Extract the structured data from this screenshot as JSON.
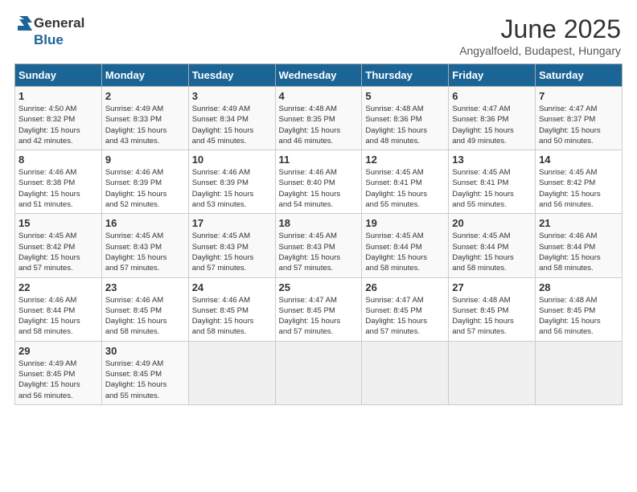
{
  "header": {
    "logo_general": "General",
    "logo_blue": "Blue",
    "main_title": "June 2025",
    "subtitle": "Angyalfoeld, Budapest, Hungary"
  },
  "calendar": {
    "days_of_week": [
      "Sunday",
      "Monday",
      "Tuesday",
      "Wednesday",
      "Thursday",
      "Friday",
      "Saturday"
    ],
    "weeks": [
      [
        {
          "day": "",
          "info": ""
        },
        {
          "day": "2",
          "info": "Sunrise: 4:49 AM\nSunset: 8:33 PM\nDaylight: 15 hours\nand 43 minutes."
        },
        {
          "day": "3",
          "info": "Sunrise: 4:49 AM\nSunset: 8:34 PM\nDaylight: 15 hours\nand 45 minutes."
        },
        {
          "day": "4",
          "info": "Sunrise: 4:48 AM\nSunset: 8:35 PM\nDaylight: 15 hours\nand 46 minutes."
        },
        {
          "day": "5",
          "info": "Sunrise: 4:48 AM\nSunset: 8:36 PM\nDaylight: 15 hours\nand 48 minutes."
        },
        {
          "day": "6",
          "info": "Sunrise: 4:47 AM\nSunset: 8:36 PM\nDaylight: 15 hours\nand 49 minutes."
        },
        {
          "day": "7",
          "info": "Sunrise: 4:47 AM\nSunset: 8:37 PM\nDaylight: 15 hours\nand 50 minutes."
        }
      ],
      [
        {
          "day": "1",
          "info": "Sunrise: 4:50 AM\nSunset: 8:32 PM\nDaylight: 15 hours\nand 42 minutes."
        },
        null,
        null,
        null,
        null,
        null,
        null
      ],
      [
        {
          "day": "8",
          "info": "Sunrise: 4:46 AM\nSunset: 8:38 PM\nDaylight: 15 hours\nand 51 minutes."
        },
        {
          "day": "9",
          "info": "Sunrise: 4:46 AM\nSunset: 8:39 PM\nDaylight: 15 hours\nand 52 minutes."
        },
        {
          "day": "10",
          "info": "Sunrise: 4:46 AM\nSunset: 8:39 PM\nDaylight: 15 hours\nand 53 minutes."
        },
        {
          "day": "11",
          "info": "Sunrise: 4:46 AM\nSunset: 8:40 PM\nDaylight: 15 hours\nand 54 minutes."
        },
        {
          "day": "12",
          "info": "Sunrise: 4:45 AM\nSunset: 8:41 PM\nDaylight: 15 hours\nand 55 minutes."
        },
        {
          "day": "13",
          "info": "Sunrise: 4:45 AM\nSunset: 8:41 PM\nDaylight: 15 hours\nand 55 minutes."
        },
        {
          "day": "14",
          "info": "Sunrise: 4:45 AM\nSunset: 8:42 PM\nDaylight: 15 hours\nand 56 minutes."
        }
      ],
      [
        {
          "day": "15",
          "info": "Sunrise: 4:45 AM\nSunset: 8:42 PM\nDaylight: 15 hours\nand 57 minutes."
        },
        {
          "day": "16",
          "info": "Sunrise: 4:45 AM\nSunset: 8:43 PM\nDaylight: 15 hours\nand 57 minutes."
        },
        {
          "day": "17",
          "info": "Sunrise: 4:45 AM\nSunset: 8:43 PM\nDaylight: 15 hours\nand 57 minutes."
        },
        {
          "day": "18",
          "info": "Sunrise: 4:45 AM\nSunset: 8:43 PM\nDaylight: 15 hours\nand 57 minutes."
        },
        {
          "day": "19",
          "info": "Sunrise: 4:45 AM\nSunset: 8:44 PM\nDaylight: 15 hours\nand 58 minutes."
        },
        {
          "day": "20",
          "info": "Sunrise: 4:45 AM\nSunset: 8:44 PM\nDaylight: 15 hours\nand 58 minutes."
        },
        {
          "day": "21",
          "info": "Sunrise: 4:46 AM\nSunset: 8:44 PM\nDaylight: 15 hours\nand 58 minutes."
        }
      ],
      [
        {
          "day": "22",
          "info": "Sunrise: 4:46 AM\nSunset: 8:44 PM\nDaylight: 15 hours\nand 58 minutes."
        },
        {
          "day": "23",
          "info": "Sunrise: 4:46 AM\nSunset: 8:45 PM\nDaylight: 15 hours\nand 58 minutes."
        },
        {
          "day": "24",
          "info": "Sunrise: 4:46 AM\nSunset: 8:45 PM\nDaylight: 15 hours\nand 58 minutes."
        },
        {
          "day": "25",
          "info": "Sunrise: 4:47 AM\nSunset: 8:45 PM\nDaylight: 15 hours\nand 57 minutes."
        },
        {
          "day": "26",
          "info": "Sunrise: 4:47 AM\nSunset: 8:45 PM\nDaylight: 15 hours\nand 57 minutes."
        },
        {
          "day": "27",
          "info": "Sunrise: 4:48 AM\nSunset: 8:45 PM\nDaylight: 15 hours\nand 57 minutes."
        },
        {
          "day": "28",
          "info": "Sunrise: 4:48 AM\nSunset: 8:45 PM\nDaylight: 15 hours\nand 56 minutes."
        }
      ],
      [
        {
          "day": "29",
          "info": "Sunrise: 4:49 AM\nSunset: 8:45 PM\nDaylight: 15 hours\nand 56 minutes."
        },
        {
          "day": "30",
          "info": "Sunrise: 4:49 AM\nSunset: 8:45 PM\nDaylight: 15 hours\nand 55 minutes."
        },
        {
          "day": "",
          "info": ""
        },
        {
          "day": "",
          "info": ""
        },
        {
          "day": "",
          "info": ""
        },
        {
          "day": "",
          "info": ""
        },
        {
          "day": "",
          "info": ""
        }
      ]
    ]
  }
}
